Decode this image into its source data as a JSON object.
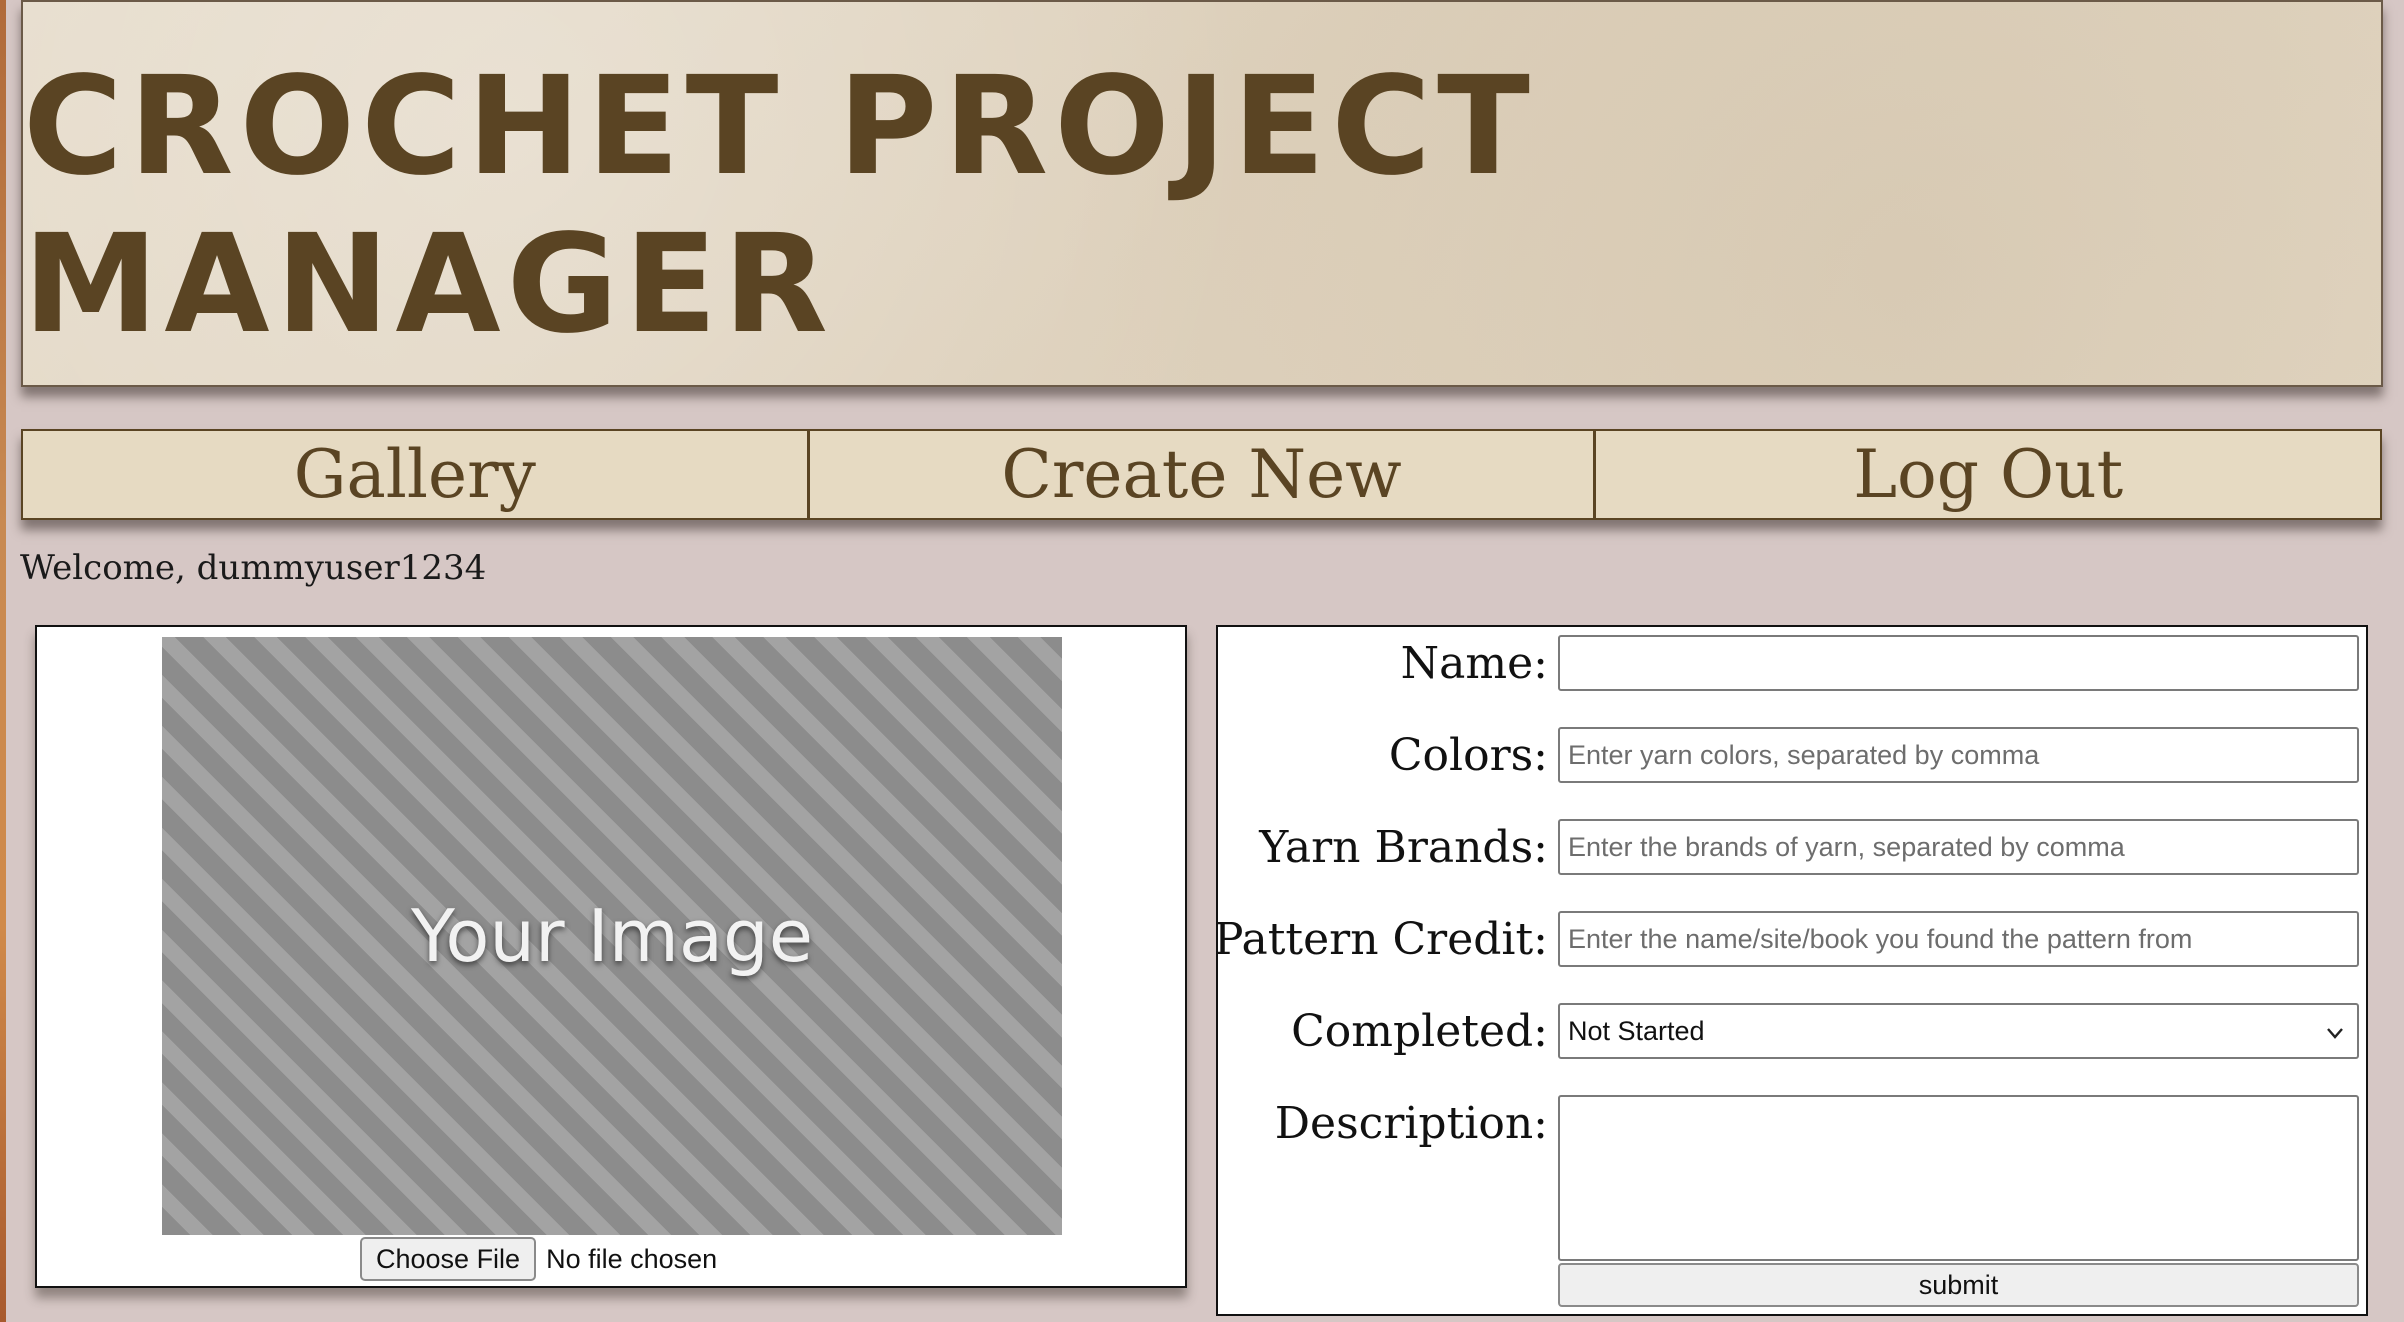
{
  "header": {
    "title": "CROCHET PROJECT MANAGER"
  },
  "nav": {
    "items": [
      {
        "label": "Gallery"
      },
      {
        "label": "Create New"
      },
      {
        "label": "Log Out"
      }
    ]
  },
  "welcome": {
    "text": "Welcome, dummyuser1234"
  },
  "image_panel": {
    "placeholder_text": "Your Image",
    "choose_file_label": "Choose File",
    "file_status": "No file chosen"
  },
  "form": {
    "name": {
      "label": "Name:",
      "value": "",
      "placeholder": ""
    },
    "colors": {
      "label": "Colors:",
      "value": "",
      "placeholder": "Enter yarn colors, separated by comma"
    },
    "yarn_brands": {
      "label": "Yarn Brands:",
      "value": "",
      "placeholder": "Enter the brands of yarn, separated by comma"
    },
    "pattern_credit": {
      "label": "Pattern Credit:",
      "value": "",
      "placeholder": "Enter the name/site/book you found the pattern from"
    },
    "completed": {
      "label": "Completed:",
      "selected": "Not Started"
    },
    "description": {
      "label": "Description:",
      "value": ""
    },
    "submit_label": "submit"
  },
  "colors": {
    "background": "#d6c7c5",
    "brand_brown": "#5a4423",
    "banner_paper": "#e2d6c2",
    "nav_bg": "#e6dac2"
  }
}
